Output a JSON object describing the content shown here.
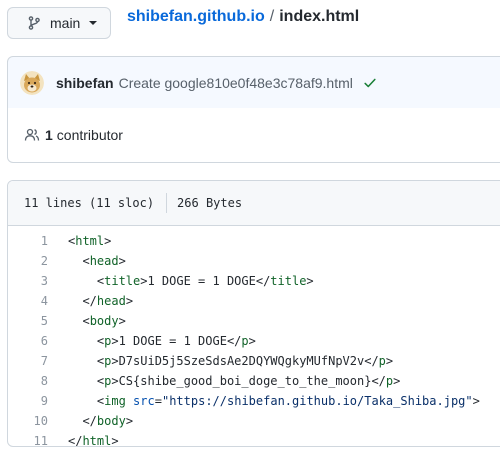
{
  "branch": {
    "label": "main",
    "icon": "git-branch-icon"
  },
  "breadcrumb": {
    "repo": "shibefan.github.io",
    "separator": "/",
    "file": "index.html"
  },
  "commit": {
    "avatar_icon": "doge-avatar",
    "author": "shibefan",
    "message": "Create google810e0f48e3c78af9.html",
    "status_icon": "check-icon",
    "status_color": "#1a7f37"
  },
  "contributors": {
    "count": "1",
    "label": "contributor"
  },
  "file_info": {
    "lines": "11 lines (11 sloc)",
    "size": "266 Bytes"
  },
  "code": {
    "line_numbers": [
      "1",
      "2",
      "3",
      "4",
      "5",
      "6",
      "7",
      "8",
      "9",
      "10",
      "11"
    ],
    "lines": [
      [
        {
          "t": "p",
          "v": "<"
        },
        {
          "t": "tag",
          "v": "html"
        },
        {
          "t": "p",
          "v": ">"
        }
      ],
      [
        {
          "t": "p",
          "v": "  <"
        },
        {
          "t": "tag",
          "v": "head"
        },
        {
          "t": "p",
          "v": ">"
        }
      ],
      [
        {
          "t": "p",
          "v": "    <"
        },
        {
          "t": "tag",
          "v": "title"
        },
        {
          "t": "p",
          "v": ">1 DOGE = 1 DOGE</"
        },
        {
          "t": "tag",
          "v": "title"
        },
        {
          "t": "p",
          "v": ">"
        }
      ],
      [
        {
          "t": "p",
          "v": "  </"
        },
        {
          "t": "tag",
          "v": "head"
        },
        {
          "t": "p",
          "v": ">"
        }
      ],
      [
        {
          "t": "p",
          "v": "  <"
        },
        {
          "t": "tag",
          "v": "body"
        },
        {
          "t": "p",
          "v": ">"
        }
      ],
      [
        {
          "t": "p",
          "v": "    <"
        },
        {
          "t": "tag",
          "v": "p"
        },
        {
          "t": "p",
          "v": ">1 DOGE = 1 DOGE</"
        },
        {
          "t": "tag",
          "v": "p"
        },
        {
          "t": "p",
          "v": ">"
        }
      ],
      [
        {
          "t": "p",
          "v": "    <"
        },
        {
          "t": "tag",
          "v": "p"
        },
        {
          "t": "p",
          "v": ">D7sUiD5j5SzeSdsAe2DQYWQgkyMUfNpV2v</"
        },
        {
          "t": "tag",
          "v": "p"
        },
        {
          "t": "p",
          "v": ">"
        }
      ],
      [
        {
          "t": "p",
          "v": "    <"
        },
        {
          "t": "tag",
          "v": "p"
        },
        {
          "t": "p",
          "v": ">CS{shibe_good_boi_doge_to_the_moon}</"
        },
        {
          "t": "tag",
          "v": "p"
        },
        {
          "t": "p",
          "v": ">"
        }
      ],
      [
        {
          "t": "p",
          "v": "    <"
        },
        {
          "t": "tag",
          "v": "img"
        },
        {
          "t": "p",
          "v": " "
        },
        {
          "t": "attr",
          "v": "src"
        },
        {
          "t": "p",
          "v": "="
        },
        {
          "t": "str",
          "v": "\"https://shibefan.github.io/Taka_Shiba.jpg\""
        },
        {
          "t": "p",
          "v": ">"
        }
      ],
      [
        {
          "t": "p",
          "v": "  </"
        },
        {
          "t": "tag",
          "v": "body"
        },
        {
          "t": "p",
          "v": ">"
        }
      ],
      [
        {
          "t": "p",
          "v": "</"
        },
        {
          "t": "tag",
          "v": "html"
        },
        {
          "t": "p",
          "v": ">"
        }
      ]
    ]
  }
}
